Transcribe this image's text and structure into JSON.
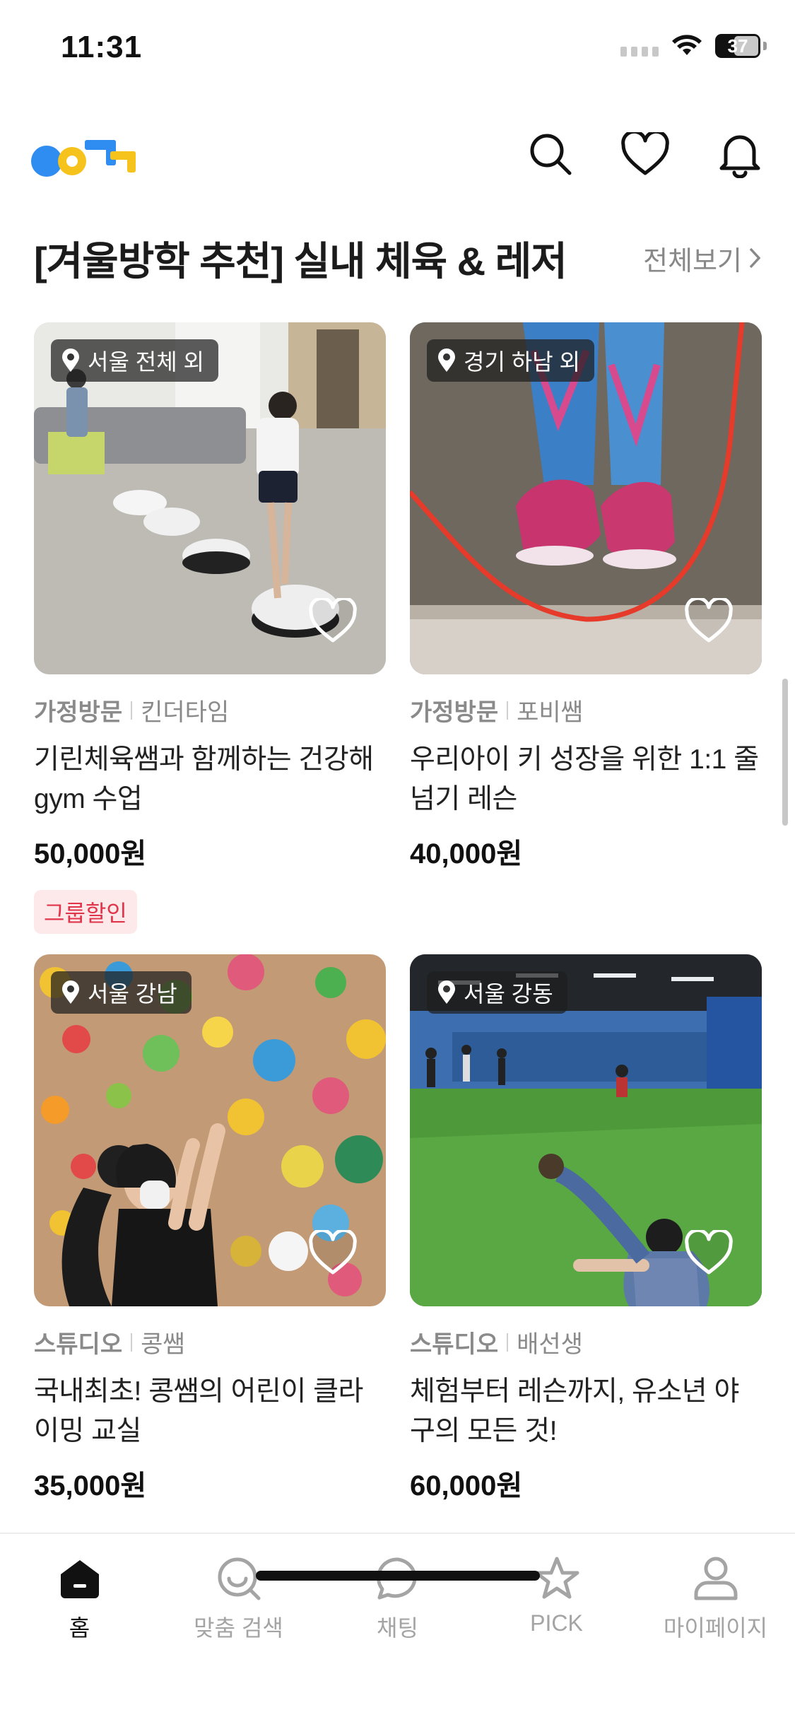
{
  "status_bar": {
    "time": "11:31",
    "battery": "37"
  },
  "header": {
    "logo_icon": "colorful-logo",
    "icons": [
      "search-icon",
      "heart-icon",
      "bell-icon"
    ]
  },
  "section": {
    "title": "[겨울방학 추천] 실내 체육 & 레저",
    "see_all": "전체보기"
  },
  "cards": [
    {
      "location": "서울 전체 외",
      "type": "가정방문",
      "teacher": "킨더타임",
      "title": "기린체육쌤과 함께하는 건강해 gym 수업",
      "price": "50,000원",
      "tag": "그룹할인"
    },
    {
      "location": "경기 하남 외",
      "type": "가정방문",
      "teacher": "포비쌤",
      "title": "우리아이 키 성장을 위한 1:1 줄넘기 레슨",
      "price": "40,000원"
    },
    {
      "location": "서울 강남",
      "type": "스튜디오",
      "teacher": "콩쌤",
      "title": "국내최초! 콩쌤의 어린이 클라이밍 교실",
      "price": "35,000원"
    },
    {
      "location": "서울 강동",
      "type": "스튜디오",
      "teacher": "배선생",
      "title": "체험부터 레슨까지, 유소년 야구의 모든 것!",
      "price": "60,000원"
    }
  ],
  "tab_bar": {
    "tabs": [
      {
        "label": "홈",
        "icon": "home-icon",
        "active": true
      },
      {
        "label": "맞춤 검색",
        "icon": "custom-search-icon"
      },
      {
        "label": "채팅",
        "icon": "chat-icon"
      },
      {
        "label": "PICK",
        "icon": "star-icon"
      },
      {
        "label": "마이페이지",
        "icon": "person-icon"
      }
    ]
  },
  "colors": {
    "accent_blue": "#2f8cf0",
    "accent_yellow": "#f6c21c",
    "tag_red": "#e0354a"
  }
}
